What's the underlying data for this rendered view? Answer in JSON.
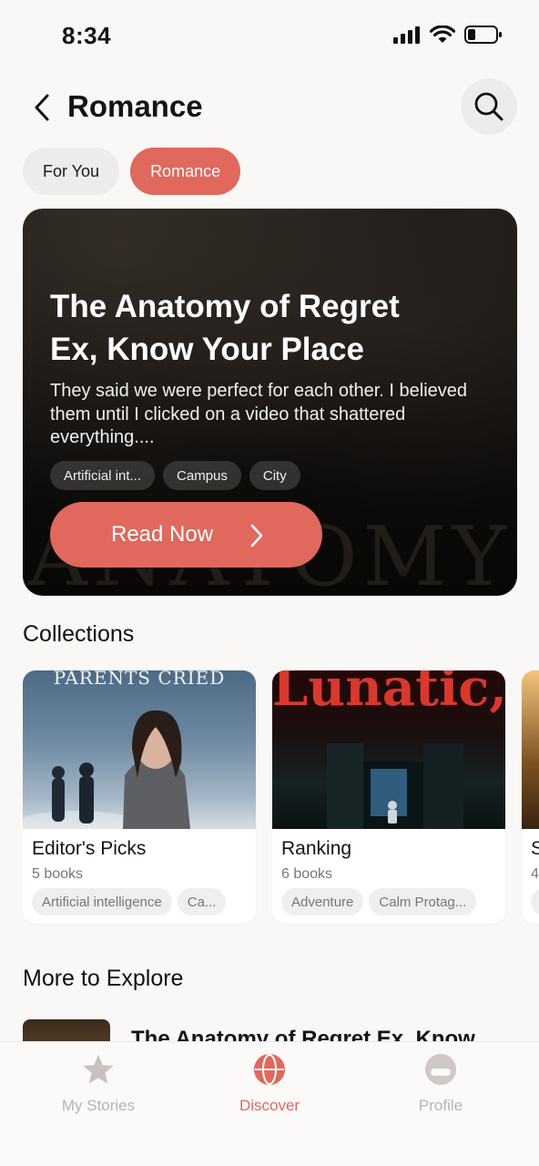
{
  "status_bar": {
    "time": "8:34"
  },
  "header": {
    "title": "Romance"
  },
  "chips": [
    {
      "label": "For You",
      "active": false
    },
    {
      "label": "Romance",
      "active": true
    }
  ],
  "hero": {
    "title_line1": "The Anatomy of Regret",
    "title_line2": "Ex, Know Your Place",
    "description": "They said we were perfect for each other. I believed them until I clicked on a video that shattered everything....",
    "tags": [
      "Artificial int...",
      "Campus",
      "City"
    ],
    "button_label": "Read Now"
  },
  "collections": {
    "section_title": "Collections",
    "items": [
      {
        "cover_text": "PARENTS CRIED",
        "name": "Editor's Picks",
        "count": "5 books",
        "tags": [
          "Artificial intelligence",
          "Ca..."
        ]
      },
      {
        "cover_text": "Lunatic,",
        "name": "Ranking",
        "count": "6 books",
        "tags": [
          "Adventure",
          "Calm Protag..."
        ]
      },
      {
        "cover_text": "",
        "name": "S",
        "count": "4",
        "tags": [
          ""
        ]
      }
    ]
  },
  "explore": {
    "section_title": "More to Explore",
    "items": [
      {
        "title": "The Anatomy of Regret Ex, Know"
      }
    ]
  },
  "tabbar": {
    "items": [
      {
        "label": "My Stories",
        "icon": "star-icon",
        "active": false
      },
      {
        "label": "Discover",
        "icon": "globe-icon",
        "active": true
      },
      {
        "label": "Profile",
        "icon": "profile-icon",
        "active": false
      }
    ]
  },
  "colors": {
    "accent": "#e0685c",
    "background": "#faf8f7",
    "inactive_tab": "#b9b3b1"
  }
}
